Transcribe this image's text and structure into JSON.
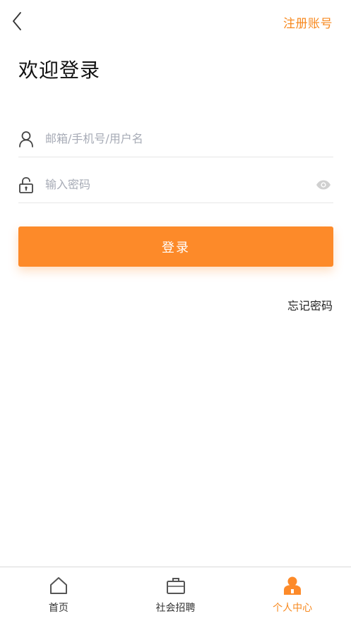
{
  "header": {
    "back_icon": "chevron-left-icon",
    "register_label": "注册账号"
  },
  "page_title": "欢迎登录",
  "form": {
    "username": {
      "icon": "user-icon",
      "value": "",
      "placeholder": "邮箱/手机号/用户名"
    },
    "password": {
      "icon": "lock-icon",
      "value": "",
      "placeholder": "输入密码",
      "toggle_icon": "eye-icon"
    },
    "login_label": "登录",
    "forgot_label": "忘记密码"
  },
  "tabbar": {
    "tabs": [
      {
        "label": "首页",
        "icon": "home-icon",
        "active": false
      },
      {
        "label": "社会招聘",
        "icon": "briefcase-icon",
        "active": false
      },
      {
        "label": "个人中心",
        "icon": "person-icon",
        "active": true
      }
    ]
  },
  "colors": {
    "accent": "#fd8a29",
    "accent_text": "#f7891f",
    "placeholder": "#a7abb6",
    "divider": "#e6e6e6",
    "icon_gray": "#555555"
  }
}
